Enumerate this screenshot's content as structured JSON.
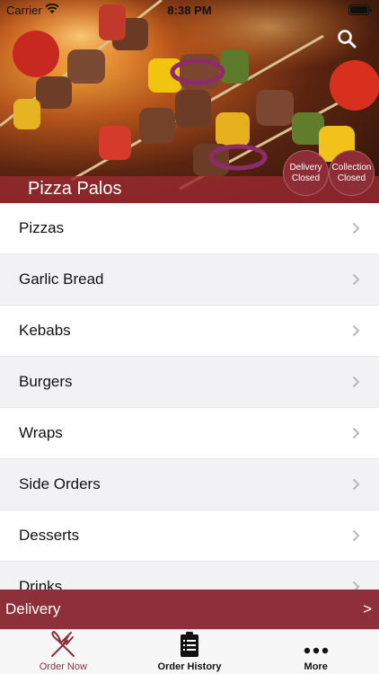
{
  "status_bar": {
    "carrier": "Carrier",
    "time": "8:38 PM"
  },
  "hero": {
    "restaurant_name": "Pizza Palos",
    "delivery_badge": [
      "Delivery",
      "Closed"
    ],
    "collection_badge": [
      "Collection",
      "Closed"
    ]
  },
  "menu": {
    "categories": [
      "Pizzas",
      "Garlic Bread",
      "Kebabs",
      "Burgers",
      "Wraps",
      "Side Orders",
      "Desserts",
      "Drinks"
    ]
  },
  "delivery_bar": {
    "label": "Delivery",
    "arrow": ">"
  },
  "tabs": [
    {
      "label": "Order Now",
      "icon": "fork-knife-icon",
      "active": true
    },
    {
      "label": "Order History",
      "icon": "clipboard-icon",
      "active": false
    },
    {
      "label": "More",
      "icon": "more-dots-icon",
      "active": false
    }
  ],
  "colors": {
    "accent": "#8e3039",
    "badge": "#8f2d36"
  }
}
